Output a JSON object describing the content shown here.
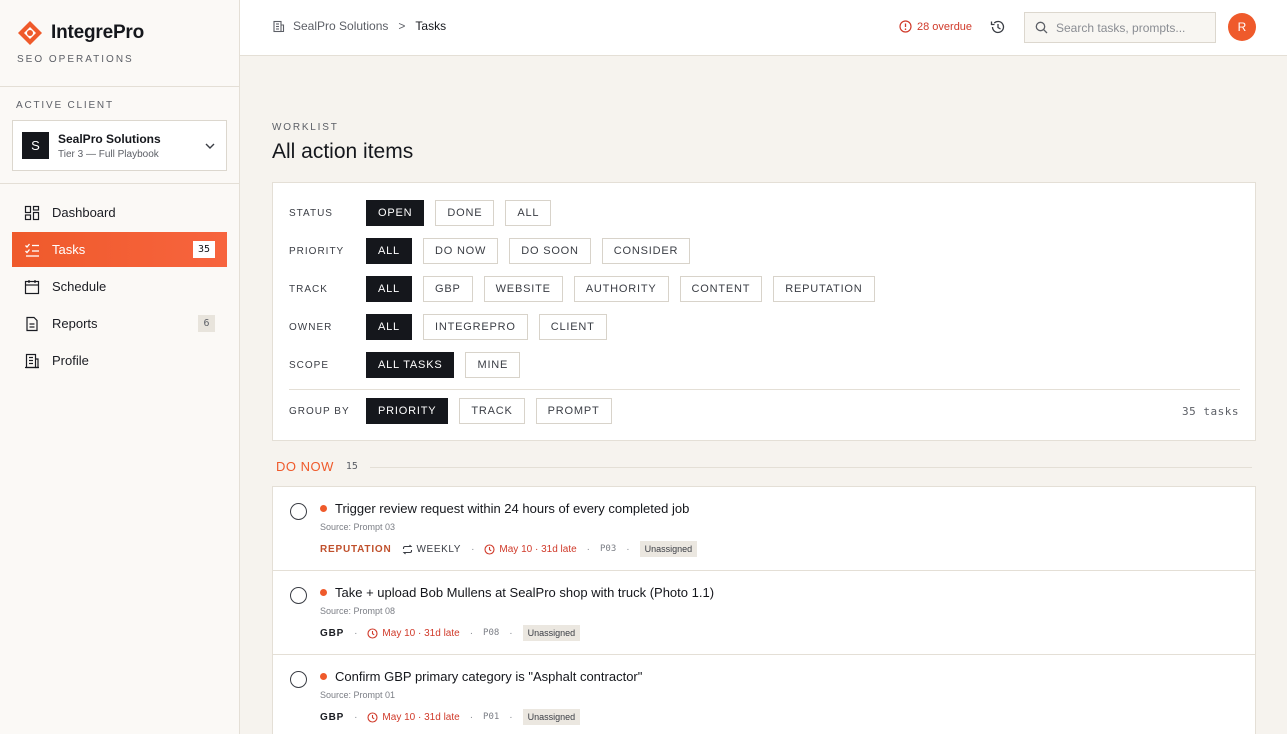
{
  "brand": {
    "name": "IntegrePro",
    "subtitle": "SEO OPERATIONS"
  },
  "client": {
    "section_label": "ACTIVE CLIENT",
    "initial": "S",
    "name": "SealPro Solutions",
    "tier": "Tier 3 — Full Playbook"
  },
  "nav": [
    {
      "label": "Dashboard",
      "icon": "dashboard-icon",
      "badge": ""
    },
    {
      "label": "Tasks",
      "icon": "tasks-icon",
      "badge": "35",
      "active": true
    },
    {
      "label": "Schedule",
      "icon": "calendar-icon",
      "badge": ""
    },
    {
      "label": "Reports",
      "icon": "report-icon",
      "badge": "6"
    },
    {
      "label": "Profile",
      "icon": "building-icon",
      "badge": ""
    }
  ],
  "topbar": {
    "breadcrumb_root": "SealPro Solutions",
    "breadcrumb_sep": ">",
    "breadcrumb_current": "Tasks",
    "overdue": "28 overdue",
    "search_placeholder": "Search tasks, prompts...",
    "user_initial": "R"
  },
  "page": {
    "eyebrow": "WORKLIST",
    "title": "All action items"
  },
  "filters": {
    "status": {
      "label": "STATUS",
      "options": [
        "OPEN",
        "DONE",
        "ALL"
      ]
    },
    "priority": {
      "label": "PRIORITY",
      "options": [
        "ALL",
        "DO NOW",
        "DO SOON",
        "CONSIDER"
      ]
    },
    "track": {
      "label": "TRACK",
      "options": [
        "ALL",
        "GBP",
        "WEBSITE",
        "AUTHORITY",
        "CONTENT",
        "REPUTATION"
      ]
    },
    "owner": {
      "label": "OWNER",
      "options": [
        "ALL",
        "INTEGREPRO",
        "CLIENT"
      ]
    },
    "scope": {
      "label": "SCOPE",
      "options": [
        "ALL TASKS",
        "MINE"
      ]
    },
    "group_by": {
      "label": "GROUP BY",
      "options": [
        "PRIORITY",
        "TRACK",
        "PROMPT"
      ]
    },
    "task_count": "35 tasks"
  },
  "group": {
    "title": "DO NOW",
    "count": "15"
  },
  "tasks": [
    {
      "title": "Trigger review request within 24 hours of every completed job",
      "source": "Source: Prompt 03",
      "track": "REPUTATION",
      "recurrence": "WEEKLY",
      "due": "May 10 · 31d late",
      "prompt_code": "P03",
      "assignee": "Unassigned"
    },
    {
      "title": "Take + upload Bob Mullens at SealPro shop with truck (Photo 1.1)",
      "source": "Source: Prompt 08",
      "track": "GBP",
      "recurrence": "",
      "due": "May 10 · 31d late",
      "prompt_code": "P08",
      "assignee": "Unassigned"
    },
    {
      "title": "Confirm GBP primary category is \"Asphalt contractor\"",
      "source": "Source: Prompt 01",
      "track": "GBP",
      "recurrence": "",
      "due": "May 10 · 31d late",
      "prompt_code": "P01",
      "assignee": "Unassigned"
    }
  ],
  "colors": {
    "accent": "#ef5a2b",
    "dark": "#15171c",
    "danger": "#d03a2a",
    "background": "#f6f3ee"
  }
}
